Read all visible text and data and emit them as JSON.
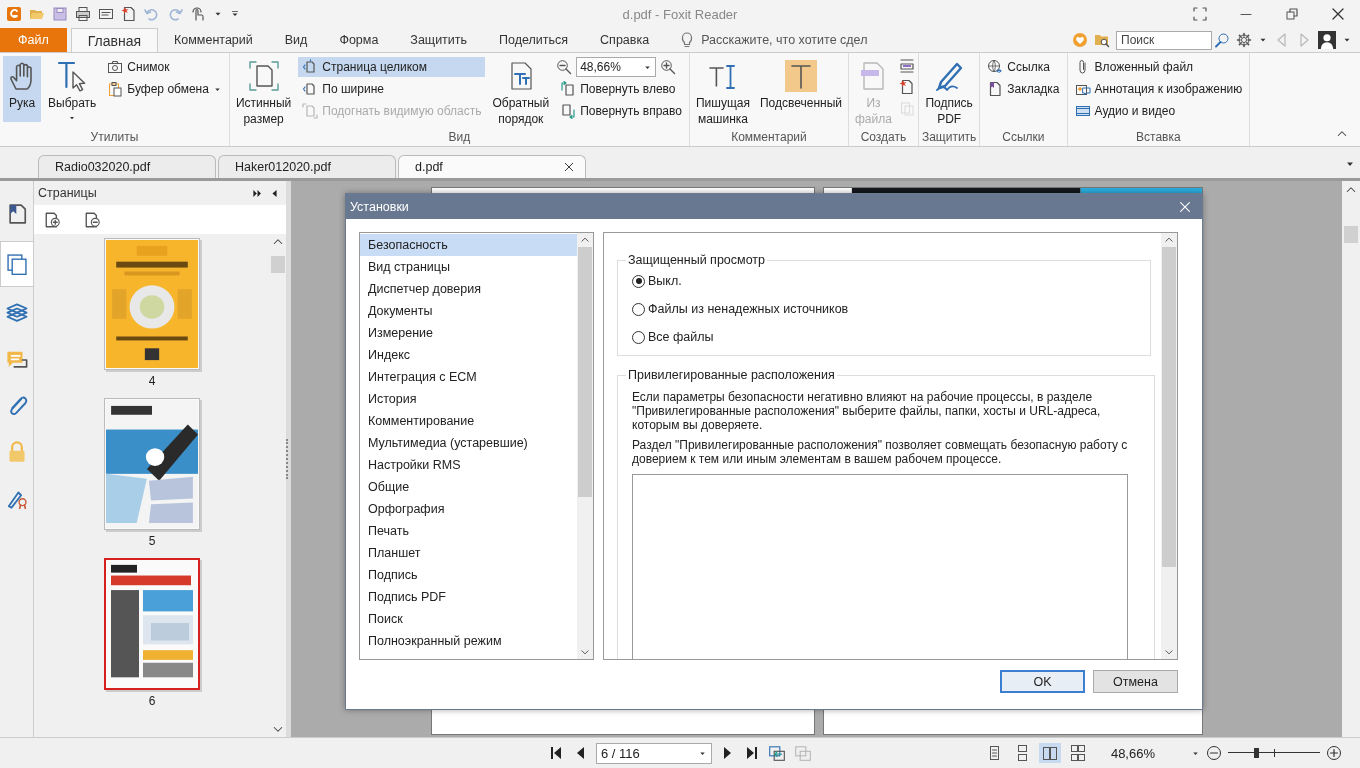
{
  "window": {
    "title": "d.pdf - Foxit Reader"
  },
  "menu_tabs": [
    {
      "label": "Файл",
      "kind": "file",
      "selected": false
    },
    {
      "label": "Главная",
      "kind": "tab",
      "selected": true
    },
    {
      "label": "Комментарий",
      "kind": "tab",
      "selected": false
    },
    {
      "label": "Вид",
      "kind": "tab",
      "selected": false
    },
    {
      "label": "Форма",
      "kind": "tab",
      "selected": false
    },
    {
      "label": "Защитить",
      "kind": "tab",
      "selected": false
    },
    {
      "label": "Поделиться",
      "kind": "tab",
      "selected": false
    },
    {
      "label": "Справка",
      "kind": "tab",
      "selected": false
    }
  ],
  "tell_me": {
    "placeholder": "Расскажите, что хотите сдел"
  },
  "search": {
    "placeholder": "Поиск"
  },
  "ribbon": [
    {
      "label": "Утилиты",
      "items": [
        {
          "kind": "large",
          "label": "Рука",
          "selected": true,
          "disabled": false
        },
        {
          "kind": "large",
          "label": "Выбрать",
          "selected": false,
          "disabled": false
        },
        {
          "kind": "small",
          "entries": [
            {
              "label": "Снимок",
              "selected": false,
              "disabled": false
            },
            {
              "label": "Буфер обмена",
              "selected": false,
              "disabled": false
            }
          ]
        }
      ]
    },
    {
      "label": "Вид",
      "items": [
        {
          "kind": "large",
          "label": "Истинный размер",
          "selected": false,
          "disabled": false
        },
        {
          "kind": "small",
          "entries": [
            {
              "label": "Страница целиком",
              "selected": true,
              "disabled": false
            },
            {
              "label": "По ширине",
              "selected": false,
              "disabled": false
            },
            {
              "label": "Подогнать видимую область",
              "selected": false,
              "disabled": true
            }
          ]
        },
        {
          "kind": "large",
          "label": "Обратный порядок",
          "selected": false,
          "disabled": false
        },
        {
          "kind": "zoom",
          "value": "48,66%",
          "entries": [
            {
              "label": "Повернуть влево",
              "selected": false,
              "disabled": false
            },
            {
              "label": "Повернуть вправо",
              "selected": false,
              "disabled": false
            }
          ]
        }
      ]
    },
    {
      "label": "Комментарий",
      "items": [
        {
          "kind": "large",
          "label": "Пишущая машинка",
          "selected": false,
          "disabled": false
        },
        {
          "kind": "large",
          "label": "Подсвеченный",
          "selected": false,
          "disabled": false
        }
      ]
    },
    {
      "label": "Создать",
      "items": [
        {
          "kind": "large",
          "label": "Из файла",
          "selected": false,
          "disabled": true
        },
        {
          "kind": "icons",
          "entries": [
            {
              "disabled": false
            },
            {
              "disabled": false
            },
            {
              "disabled": true
            }
          ]
        }
      ]
    },
    {
      "label": "Защитить",
      "items": [
        {
          "kind": "large",
          "label": "Подпись PDF",
          "selected": false,
          "disabled": false
        }
      ]
    },
    {
      "label": "Ссылки",
      "items": [
        {
          "kind": "small",
          "entries": [
            {
              "label": "Ссылка",
              "selected": false,
              "disabled": false
            },
            {
              "label": "Закладка",
              "selected": false,
              "disabled": false
            }
          ]
        }
      ]
    },
    {
      "label": "Вставка",
      "items": [
        {
          "kind": "small",
          "entries": [
            {
              "label": "Вложенный файл",
              "selected": false,
              "disabled": false
            },
            {
              "label": "Аннотация к изображению",
              "selected": false,
              "disabled": false
            },
            {
              "label": "Аудио и видео",
              "selected": false,
              "disabled": false
            }
          ]
        }
      ]
    }
  ],
  "doc_tabs": [
    {
      "label": "Radio032020.pdf",
      "selected": false
    },
    {
      "label": "Haker012020.pdf",
      "selected": false
    },
    {
      "label": "d.pdf",
      "selected": true
    }
  ],
  "side_tools": [
    {
      "selected": false
    },
    {
      "selected": true
    },
    {
      "selected": false
    },
    {
      "selected": false
    },
    {
      "selected": false
    },
    {
      "selected": false
    },
    {
      "selected": false
    }
  ],
  "pages_panel": {
    "title": "Страницы",
    "thumbnails": [
      {
        "page": "4",
        "selected": false
      },
      {
        "page": "5",
        "selected": false
      },
      {
        "page": "6",
        "selected": true
      }
    ]
  },
  "dialog": {
    "title": "Установки",
    "categories": [
      {
        "label": "Безопасность",
        "selected": true
      },
      {
        "label": "Вид страницы",
        "selected": false
      },
      {
        "label": "Диспетчер доверия",
        "selected": false
      },
      {
        "label": "Документы",
        "selected": false
      },
      {
        "label": "Измерение",
        "selected": false
      },
      {
        "label": "Индекс",
        "selected": false
      },
      {
        "label": "Интеграция с ECM",
        "selected": false
      },
      {
        "label": "История",
        "selected": false
      },
      {
        "label": "Комментирование",
        "selected": false
      },
      {
        "label": "Мультимедиа (устаревшие)",
        "selected": false
      },
      {
        "label": "Настройки RMS",
        "selected": false
      },
      {
        "label": "Общие",
        "selected": false
      },
      {
        "label": "Орфография",
        "selected": false
      },
      {
        "label": "Печать",
        "selected": false
      },
      {
        "label": "Планшет",
        "selected": false
      },
      {
        "label": "Подпись",
        "selected": false
      },
      {
        "label": "Подпись PDF",
        "selected": false
      },
      {
        "label": "Поиск",
        "selected": false
      },
      {
        "label": "Полноэкранный режим",
        "selected": false
      }
    ],
    "protected_view": {
      "title": "Защищенный просмотр",
      "options": [
        {
          "label": "Выкл.",
          "selected": true
        },
        {
          "label": "Файлы из ненадежных источников",
          "selected": false
        },
        {
          "label": "Все файлы",
          "selected": false
        }
      ]
    },
    "privileged": {
      "title": "Привилегированные расположения",
      "paragraphs": [
        "Если параметры безопасности негативно влияют на рабочие процессы, в разделе \"Привилегированные расположения\" выберите файлы, папки, хосты и URL-адреса, которым вы доверяете.",
        "Раздел \"Привилегированные расположения\" позволяет совмещать безопасную работу с доверием к тем или иным элементам в вашем рабочем процессе."
      ]
    },
    "buttons": [
      {
        "label": "OK",
        "kind": "default"
      },
      {
        "label": "Отмена",
        "kind": "normal"
      }
    ]
  },
  "status_bar": {
    "page_field": "6 / 116",
    "view_modes": [
      {
        "selected": false
      },
      {
        "selected": false
      },
      {
        "selected": true
      },
      {
        "selected": false
      }
    ],
    "zoom": "48,66%",
    "zoom_slider": {
      "level": 0.3
    }
  }
}
